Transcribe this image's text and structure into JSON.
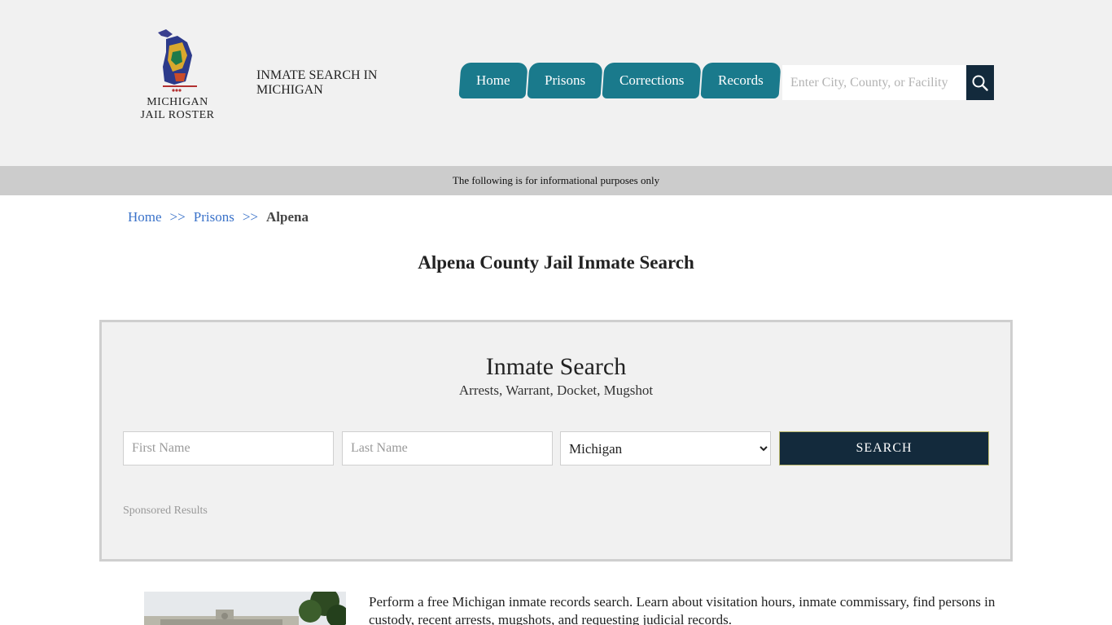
{
  "header": {
    "logo_line1": "MICHIGAN",
    "logo_line2": "JAIL ROSTER",
    "tagline": "INMATE SEARCH IN MICHIGAN",
    "nav": [
      {
        "label": "Home"
      },
      {
        "label": "Prisons"
      },
      {
        "label": "Corrections"
      },
      {
        "label": "Records"
      }
    ],
    "search_placeholder": "Enter City, County, or Facility",
    "search_icon": "search-icon"
  },
  "info_bar": "The following is for informational purposes only",
  "breadcrumb": {
    "items": [
      "Home",
      "Prisons"
    ],
    "separator": ">>",
    "current": "Alpena"
  },
  "page_title": "Alpena County Jail Inmate Search",
  "search_panel": {
    "title": "Inmate Search",
    "subtitle": "Arrests, Warrant, Docket, Mugshot",
    "first_name_placeholder": "First Name",
    "last_name_placeholder": "Last Name",
    "state_selected": "Michigan",
    "submit_label": "SEARCH",
    "sponsored_label": "Sponsored Results"
  },
  "intro_text": "Perform a free Michigan inmate records search. Learn about visitation hours, inmate commissary, find persons in custody, recent arrests, mugshots, and requesting judicial records.",
  "colors": {
    "header_bg": "#f1f1f1",
    "nav_teal": "#1a7a8c",
    "dark_navy": "#132a3c",
    "link_blue": "#3a72c9",
    "info_bar_bg": "#cccccc"
  }
}
